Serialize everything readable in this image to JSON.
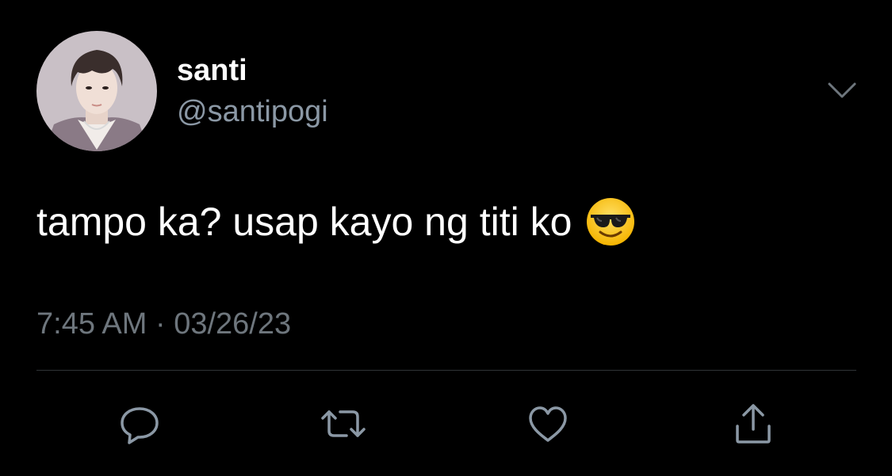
{
  "tweet": {
    "author": {
      "display_name": "santi",
      "handle": "@santipogi"
    },
    "text": "tampo ka? usap kayo ng titi ko",
    "emoji": "smiling-face-with-sunglasses",
    "time": "7:45 AM",
    "separator": " · ",
    "date": "03/26/23"
  },
  "icons": {
    "more": "chevron-down-icon",
    "reply": "reply-icon",
    "retweet": "retweet-icon",
    "like": "heart-icon",
    "share": "share-icon"
  },
  "colors": {
    "background": "#000000",
    "primary_text": "#ffffff",
    "secondary_text": "#6e767d",
    "icon": "#8b98a5",
    "divider": "#2f3336"
  }
}
